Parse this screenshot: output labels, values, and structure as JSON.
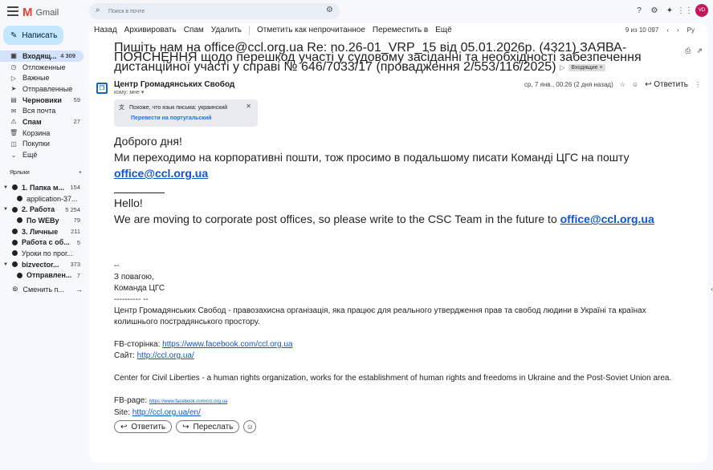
{
  "app": {
    "name": "Gmail",
    "avatar_initials": "VD"
  },
  "search": {
    "placeholder": "Поиск в почте"
  },
  "compose": {
    "label": "Написать"
  },
  "nav": [
    {
      "label": "Входящ...",
      "count": "4 309",
      "icon": "inbox-icon",
      "glyph": "▣",
      "active": true,
      "bold": true
    },
    {
      "label": "Отложенные",
      "count": "",
      "icon": "clock-icon",
      "glyph": "◷",
      "active": false,
      "bold": false
    },
    {
      "label": "Важные",
      "count": "",
      "icon": "label-important-icon",
      "glyph": "▷",
      "active": false,
      "bold": false
    },
    {
      "label": "Отправленные",
      "count": "",
      "icon": "send-icon",
      "glyph": "➤",
      "active": false,
      "bold": false
    },
    {
      "label": "Черновики",
      "count": "59",
      "icon": "draft-icon",
      "glyph": "▤",
      "active": false,
      "bold": true
    },
    {
      "label": "Вся почта",
      "count": "",
      "icon": "all-mail-icon",
      "glyph": "✉",
      "active": false,
      "bold": false
    },
    {
      "label": "Спам",
      "count": "27",
      "icon": "spam-icon",
      "glyph": "⚠",
      "active": false,
      "bold": true
    },
    {
      "label": "Корзина",
      "count": "",
      "icon": "trash-icon",
      "glyph": "🗑",
      "active": false,
      "bold": false
    },
    {
      "label": "Покупки",
      "count": "",
      "icon": "shopping-icon",
      "glyph": "◫",
      "active": false,
      "bold": false
    },
    {
      "label": "Ещё",
      "count": "",
      "icon": "chevron-down-icon",
      "glyph": "⌄",
      "active": false,
      "bold": false
    }
  ],
  "labels_header": "Ярлыки",
  "labels": [
    {
      "label": "1. Папка м...",
      "count": "154",
      "bold": true,
      "caret": true,
      "indent": 0
    },
    {
      "label": "application-37...",
      "count": "",
      "bold": false,
      "caret": false,
      "indent": 1
    },
    {
      "label": "2. Работа",
      "count": "5 254",
      "bold": true,
      "caret": true,
      "indent": 0
    },
    {
      "label": "По WEBу",
      "count": "79",
      "bold": true,
      "caret": false,
      "indent": 1
    },
    {
      "label": "3. Личные",
      "count": "211",
      "bold": true,
      "caret": false,
      "indent": 0
    },
    {
      "label": "Работа с об...",
      "count": "5",
      "bold": true,
      "caret": false,
      "indent": 0
    },
    {
      "label": "Уроки по прог...",
      "count": "",
      "bold": false,
      "caret": false,
      "indent": 0
    },
    {
      "label": "bizvector...",
      "count": "373",
      "bold": true,
      "caret": true,
      "indent": 0
    },
    {
      "label": "Отправлен...",
      "count": "7",
      "bold": true,
      "caret": false,
      "indent": 1
    }
  ],
  "switch_label": "Сменить п...",
  "toolbar": {
    "back": "Назад",
    "archive": "Архивировать",
    "spam": "Спам",
    "delete": "Удалить",
    "mark_unread": "Отметить как непрочитанное",
    "move_to": "Переместить в",
    "more": "Ещё"
  },
  "pager": {
    "text": "9 из 10 097",
    "lang": "Ру"
  },
  "email": {
    "subject": "Пишіть нам на office@ccl.org.ua Re: no.26-01_VRP_15 від 05.01.2026р. (4321) ЗАЯВА-ПОЯСНЕННЯ щодо перешкод участі у судовому засіданні та необхідності забезпечення дистанційної участі у справі № 646/7033/17 (провадження 2/553/116/2025)",
    "chip": "Входящие ×",
    "sender": "Центр Громадянських Свобод",
    "to": "кому: мне ▾",
    "date": "ср, 7 янв., 00:26 (2 дня назад)",
    "reply_label": "Ответить",
    "translate_text": "Похоже, что язык письма: украинский",
    "translate_link": "Перевести на португальский",
    "greeting_ua": "Доброго дня!",
    "line_ua": "Ми переходимо на корпоративні пошти, тож просимо в подальшому писати Команді ЦГС на пошту ",
    "email_link": "office@ccl.org.ua",
    "greeting_en": "Hello!",
    "line_en": "We are moving to corporate post offices, so please write to the CSC Team in the future to ",
    "sig_dash": "--",
    "sig_regards": "З повагою,",
    "sig_team": "Команда ЦГС",
    "sig_dashes": "---------- --",
    "sig_desc_ua": "Центр Громадянських Свобод - правозахисна організація, яка працює для реального утвердження прав та свобод людини в Україні та країнах колишнього пострадянського простору.",
    "fb_label_ua": "FB-сторінка: ",
    "fb_url_ua": "https://www.facebook.com/ccl.org.ua",
    "site_label_ua": "Сайт: ",
    "site_url_ua": "http://ccl.org.ua/",
    "sig_desc_en": "Center for Civil Liberties - a human rights organization, works for the establishment of human rights and freedoms in Ukraine and the Post-Soviet Union area.",
    "fb_label_en": "FB-page: ",
    "fb_url_en": "https://www.facebook.com/ccl.org.ua",
    "site_label_en": "Site: ",
    "site_url_en": "http://ccl.org.ua/en/"
  },
  "actions": {
    "reply": "Ответить",
    "forward": "Переслать"
  }
}
